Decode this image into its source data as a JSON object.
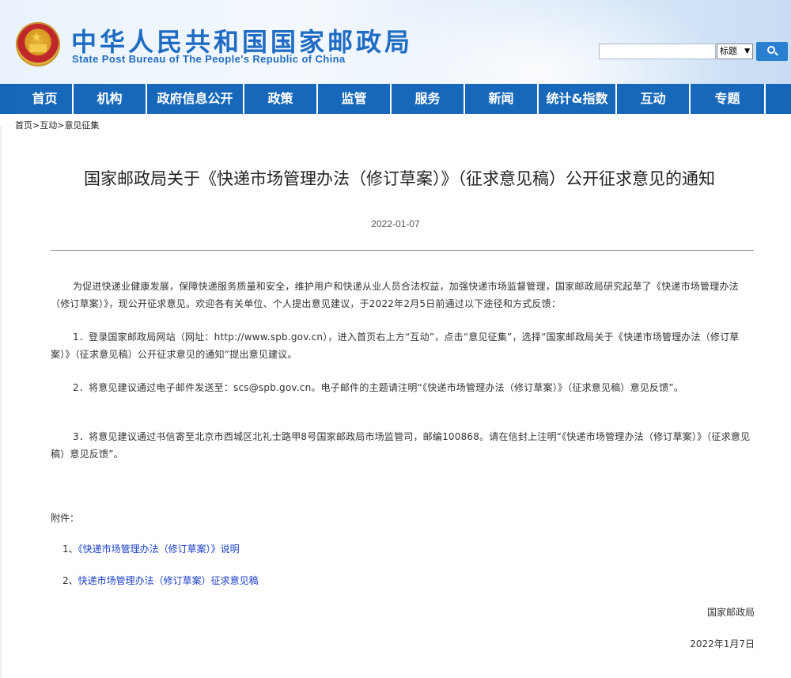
{
  "header": {
    "title": "中华人民共和国国家邮政局",
    "subtitle": "State Post Bureau of The People's Republic of China",
    "search": {
      "placeholder": "",
      "select_value": "标题",
      "button_icon": "search-icon"
    }
  },
  "nav": {
    "items": [
      {
        "label": "首页"
      },
      {
        "label": "机构"
      },
      {
        "label": "政府信息公开"
      },
      {
        "label": "政策"
      },
      {
        "label": "监管"
      },
      {
        "label": "服务"
      },
      {
        "label": "新闻"
      },
      {
        "label": "统计&指数"
      },
      {
        "label": "互动"
      },
      {
        "label": "专题"
      }
    ]
  },
  "breadcrumb": {
    "items": [
      "首页",
      "互动",
      "意见征集"
    ],
    "separator": ">"
  },
  "article": {
    "title": "国家邮政局关于《快递市场管理办法（修订草案）》（征求意见稿）公开征求意见的通知",
    "date": "2022-01-07",
    "paragraphs": [
      "为促进快递业健康发展，保障快递服务质量和安全，维护用户和快递从业人员合法权益，加强快递市场监督管理，国家邮政局研究起草了《快递市场管理办法（修订草案）》，现公开征求意见。欢迎各有关单位、个人提出意见建议，于2022年2月5日前通过以下途径和方式反馈：",
      "1．登录国家邮政局网站（网址：http://www.spb.gov.cn），进入首页右上方“互动”，点击“意见征集”，选择“国家邮政局关于《快递市场管理办法（修订草案）》（征求意见稿）公开征求意见的通知”提出意见建议。",
      "2．将意见建议通过电子邮件发送至：scs@spb.gov.cn。电子邮件的主题请注明“《快递市场管理办法（修订草案）》（征求意见稿）意见反馈”。",
      "3．将意见建议通过书信寄至北京市西城区北礼士路甲8号国家邮政局市场监管司，邮编100868。请在信封上注明“《快递市场管理办法（修订草案）》（征求意见稿）意见反馈”。"
    ],
    "attachments_label": "附件：",
    "attachments": [
      {
        "num": "1、",
        "label": "《快递市场管理办法（修订草案）》说明"
      },
      {
        "num": "2、",
        "label": "快递市场管理办法（修订草案）征求意见稿"
      }
    ],
    "signature_org": "国家邮政局",
    "signature_date": "2022年1月7日"
  },
  "colors": {
    "brand_blue": "#1f6cc4",
    "nav_blue": "#1768bb",
    "link_blue": "#1a3fc8"
  }
}
